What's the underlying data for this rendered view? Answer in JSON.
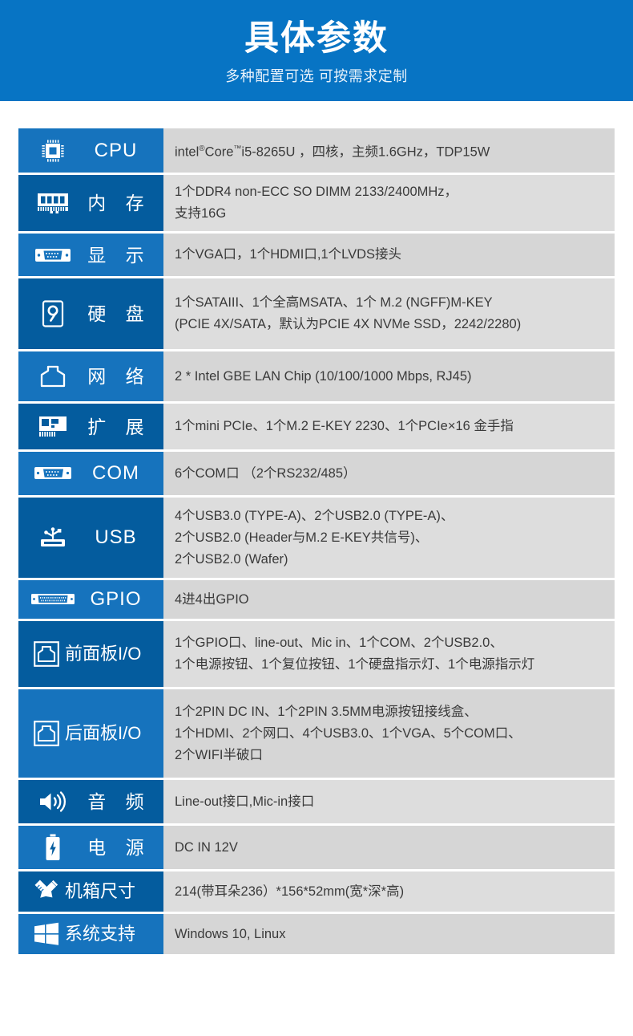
{
  "banner": {
    "title": "具体参数",
    "subtitle": "多种配置可选 可按需求定制",
    "background_color": "#0774c4"
  },
  "colors": {
    "label_light_blue": "#1673bd",
    "label_dark_blue": "#045c9e",
    "value_gray_a": "#d6d6d6",
    "value_gray_b": "#dddddd",
    "label_text": "#ffffff",
    "value_text": "#3a3a3a"
  },
  "spec_table": {
    "rows": [
      {
        "icon": "cpu-chip-icon",
        "label": "CPU",
        "lines": [
          "intel®Core™i5-8265U ，四核，主频1.6GHz，TDP15W"
        ]
      },
      {
        "icon": "memory-module-icon",
        "label": "内 存",
        "lines": [
          "1个DDR4 non-ECC SO DIMM 2133/2400MHz，",
          "支持16G"
        ]
      },
      {
        "icon": "vga-port-icon",
        "label": "显 示",
        "lines": [
          "1个VGA口，1个HDMI口,1个LVDS接头"
        ]
      },
      {
        "icon": "hard-disk-icon",
        "label": "硬 盘",
        "lines": [
          "1个SATAIII、1个全高MSATA、1个 M.2 (NGFF)M-KEY",
          "(PCIE 4X/SATA，默认为PCIE 4X NVMe SSD，2242/2280)"
        ]
      },
      {
        "icon": "rj45-network-icon",
        "label": "网 络",
        "lines": [
          "2 * Intel GBE LAN Chip (10/100/1000 Mbps, RJ45)"
        ]
      },
      {
        "icon": "expansion-card-icon",
        "label": "扩 展",
        "lines": [
          "1个mini PCIe、1个M.2 E-KEY 2230、1个PCIe×16 金手指"
        ]
      },
      {
        "icon": "com-serial-port-icon",
        "label": "COM",
        "lines": [
          "6个COM口 （2个RS232/485）"
        ]
      },
      {
        "icon": "usb-icon",
        "label": "USB",
        "lines": [
          "4个USB3.0 (TYPE-A)、2个USB2.0 (TYPE-A)、",
          "2个USB2.0 (Header与M.2 E-KEY共信号)、",
          "2个USB2.0 (Wafer)"
        ]
      },
      {
        "icon": "gpio-connector-icon",
        "label": "GPIO",
        "lines": [
          "4进4出GPIO"
        ]
      },
      {
        "icon": "panel-io-icon",
        "label": "前面板I/O",
        "lines": [
          "1个GPIO口、line-out、Mic in、1个COM、2个USB2.0、",
          "1个电源按钮、1个复位按钮、1个硬盘指示灯、1个电源指示灯"
        ]
      },
      {
        "icon": "panel-io-icon",
        "label": "后面板I/O",
        "lines": [
          "1个2PIN DC IN、1个2PIN 3.5MM电源按钮接线盒、",
          "1个HDMI、2个网口、4个USB3.0、1个VGA、5个COM口、",
          "2个WIFI半破口"
        ]
      },
      {
        "icon": "speaker-audio-icon",
        "label": "音 频",
        "lines": [
          "Line-out接口,Mic-in接口"
        ]
      },
      {
        "icon": "battery-power-icon",
        "label": "电 源",
        "lines": [
          "DC IN 12V"
        ]
      },
      {
        "icon": "ruler-pencil-icon",
        "label": "机箱尺寸",
        "lines": [
          "214(带耳朵236）*156*52mm(宽*深*高)"
        ]
      },
      {
        "icon": "windows-logo-icon",
        "label": "系统支持",
        "lines": [
          "Windows 10, Linux"
        ]
      }
    ]
  }
}
